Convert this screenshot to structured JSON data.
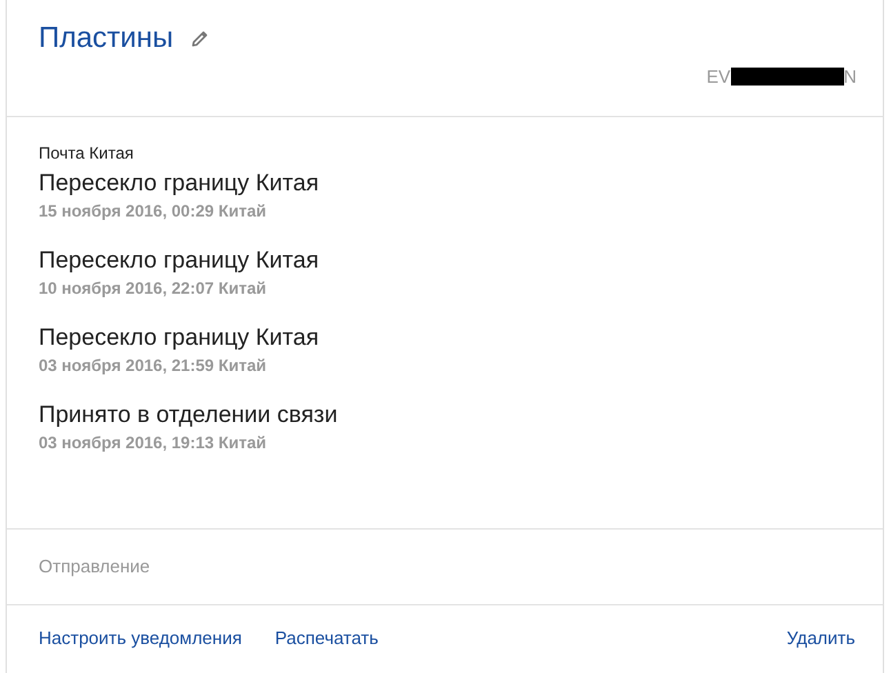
{
  "header": {
    "title": "Пластины",
    "tracking": {
      "prefix": "EV",
      "suffix": "N",
      "redacted": true
    }
  },
  "events": {
    "carrier": "Почта Китая",
    "items": [
      {
        "status": "Пересекло границу Китая",
        "details": "15 ноября 2016, 00:29 Китай"
      },
      {
        "status": "Пересекло границу Китая",
        "details": "10 ноября 2016, 22:07 Китай"
      },
      {
        "status": "Пересекло границу Китая",
        "details": "03 ноября 2016, 21:59 Китай"
      },
      {
        "status": "Принято в отделении связи",
        "details": "03 ноября 2016, 19:13 Китай"
      }
    ]
  },
  "section": "Отправление",
  "actions": [
    {
      "label": "Настроить уведомления",
      "kind": "left"
    },
    {
      "label": "Распечатать",
      "kind": "left"
    },
    {
      "label": "Удалить",
      "kind": "right"
    }
  ]
}
